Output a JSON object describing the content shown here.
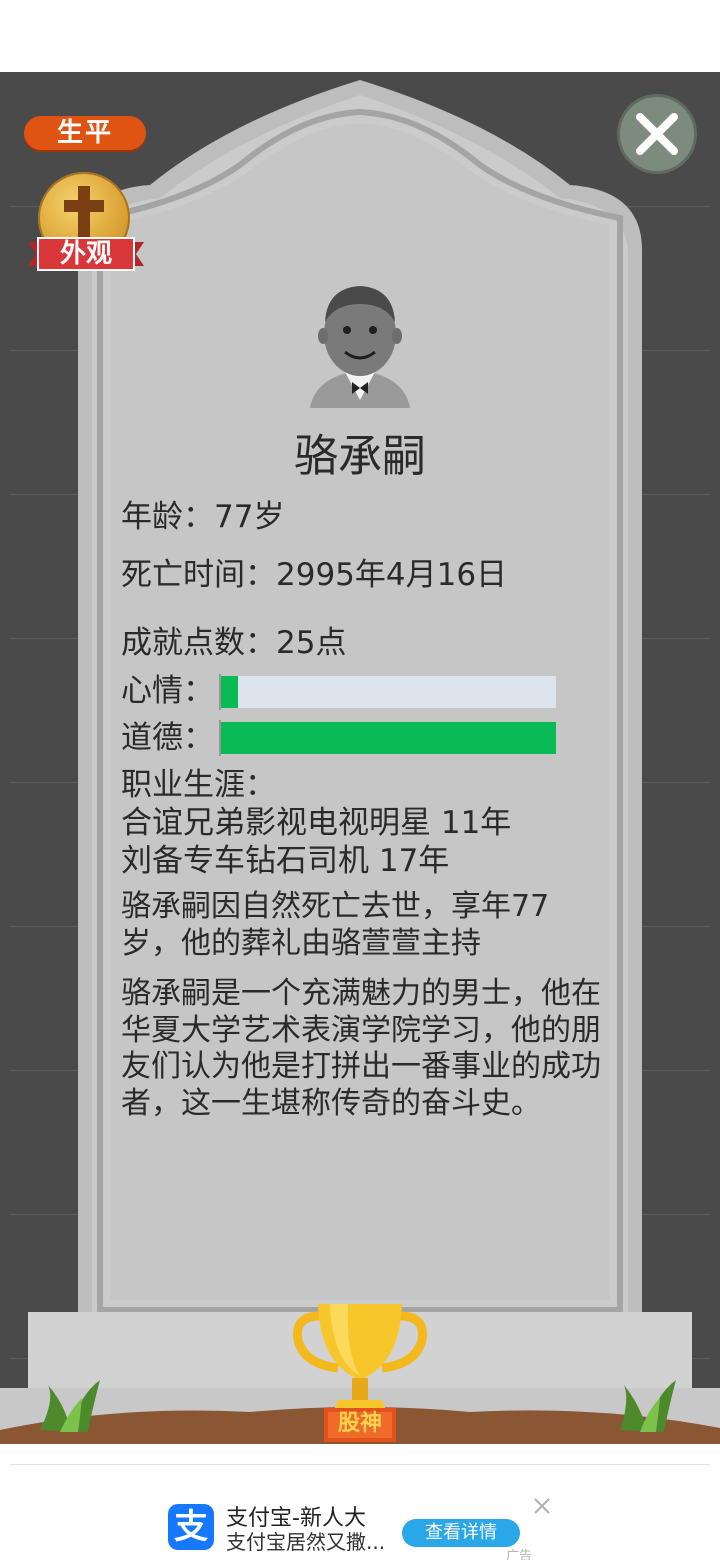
{
  "header": {
    "life_tab": "生平",
    "appearance_label": "外观"
  },
  "profile": {
    "name": "骆承嗣",
    "age": "年龄：77岁",
    "death_time": "死亡时间：2995年4月16日",
    "achievement_points": "成就点数：25点",
    "mood_label": "心情：",
    "mood_level": 0.05,
    "morality_label": "道德：",
    "morality_level": 1.0,
    "career_title": "职业生涯：",
    "careers": [
      "合谊兄弟影视电视明星 11年",
      "刘备专车钻石司机 17年"
    ],
    "death_summary": "骆承嗣因自然死亡去世，享年77岁，他的葬礼由骆萱萱主持",
    "biography": "骆承嗣是一个充满魅力的男士，他在华夏大学艺术表演学院学习，他的朋友们认为他是打拼出一番事业的成功者，这一生堪称传奇的奋斗史。"
  },
  "trophy": {
    "label": "股神"
  },
  "ad": {
    "title": "支付宝-新人大",
    "subtitle": "支付宝居然又撒...",
    "cta": "查看详情",
    "tag": "广告"
  },
  "colors": {
    "life_tab": "#e05413",
    "bar_fill": "#08bb55",
    "bar_track": "#dde4ee",
    "stone": "#c2c2c2",
    "background": "#4a4a4a"
  }
}
